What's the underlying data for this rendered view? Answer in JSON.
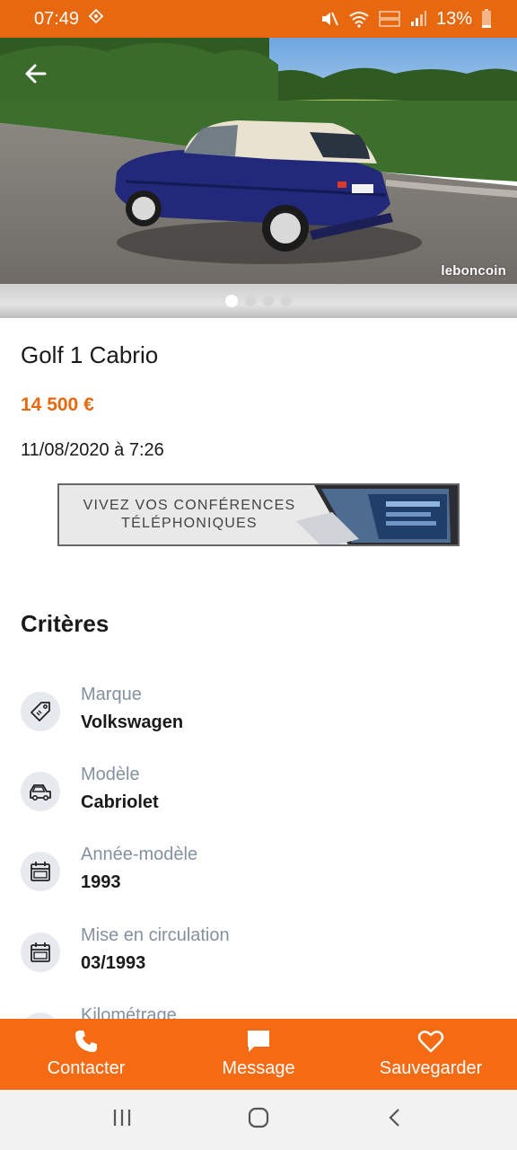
{
  "status_bar": {
    "time": "07:49",
    "battery": "13%"
  },
  "listing": {
    "title": "Golf 1 Cabrio",
    "price": "14 500 €",
    "date": "11/08/2020 à 7:26",
    "watermark": "leboncoin",
    "photo_count": 4,
    "active_photo": 1
  },
  "ad": {
    "line1": "VIVEZ VOS CONFÉRENCES",
    "line2": "TÉLÉPHONIQUES"
  },
  "criteria": {
    "title": "Critères",
    "items": [
      {
        "label": "Marque",
        "value": "Volkswagen",
        "icon": "tag-icon"
      },
      {
        "label": "Modèle",
        "value": "Cabriolet",
        "icon": "car-icon"
      },
      {
        "label": "Année-modèle",
        "value": "1993",
        "icon": "calendar-icon"
      },
      {
        "label": "Mise en circulation",
        "value": "03/1993",
        "icon": "calendar-icon"
      },
      {
        "label": "Kilométrage",
        "value": "",
        "icon": "speedometer-icon"
      }
    ]
  },
  "actions": {
    "contact": "Contacter",
    "message": "Message",
    "save": "Sauvegarder"
  },
  "colors": {
    "brand": "#f56b14",
    "status_bar": "#e7680f",
    "label": "#8391a0"
  }
}
